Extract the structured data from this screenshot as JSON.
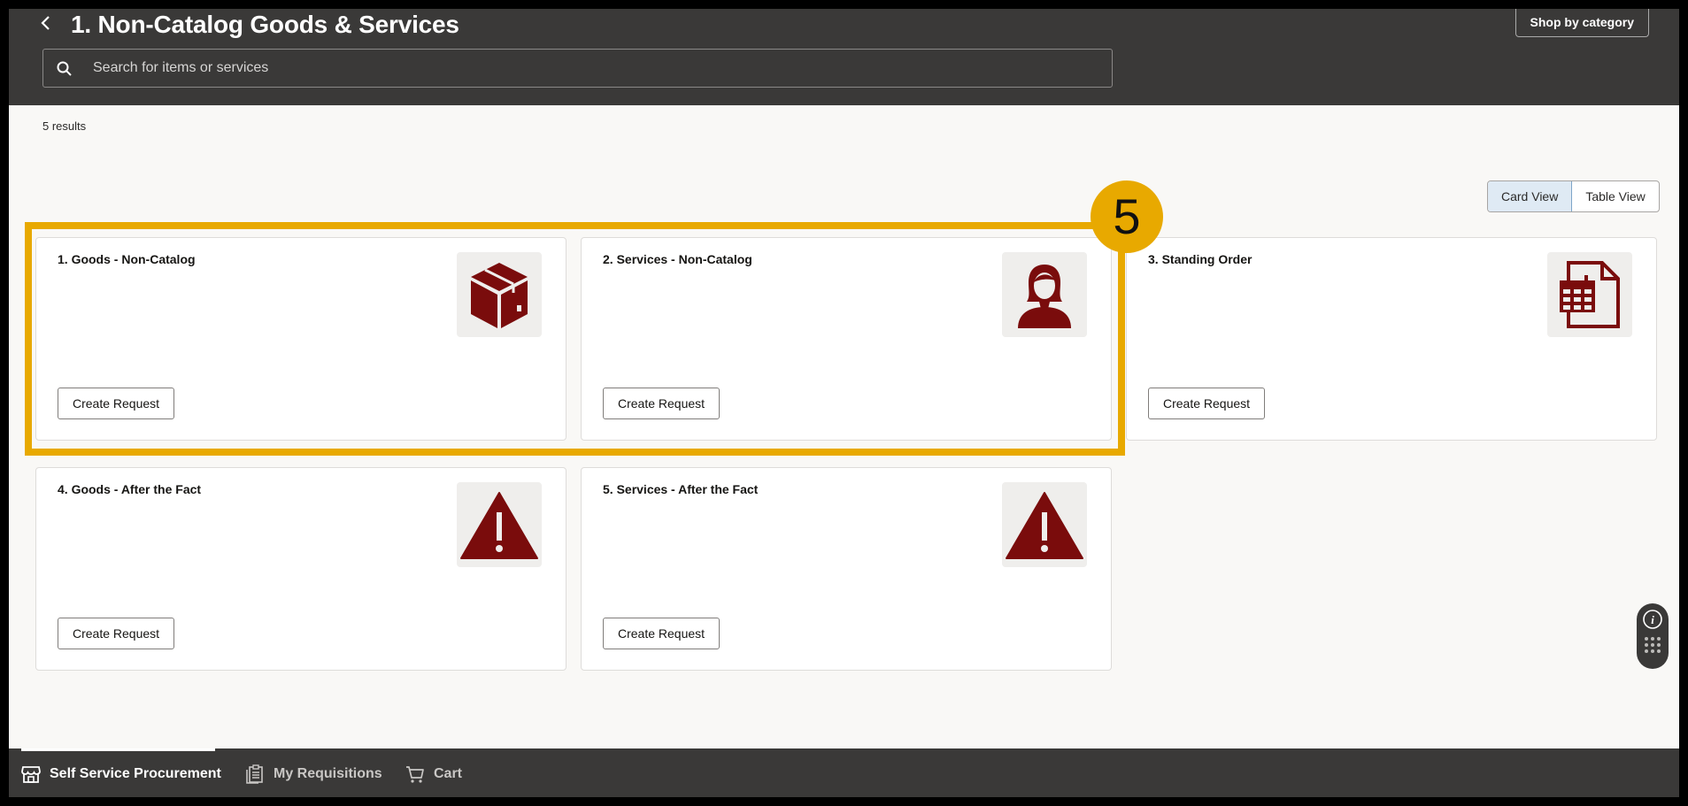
{
  "header": {
    "title": "1. Non-Catalog Goods & Services",
    "shop_by_category": "Shop by category",
    "search_placeholder": "Search for items or services"
  },
  "results_count": "5 results",
  "view_toggle": {
    "card": "Card View",
    "table": "Table View",
    "selected": "Card View"
  },
  "cards": [
    {
      "title": "1. Goods - Non-Catalog",
      "button": "Create Request",
      "icon": "package-icon"
    },
    {
      "title": "2. Services - Non-Catalog",
      "button": "Create Request",
      "icon": "person-icon"
    },
    {
      "title": "3. Standing Order",
      "button": "Create Request",
      "icon": "calendar-document-icon"
    },
    {
      "title": "4. Goods - After the Fact",
      "button": "Create Request",
      "icon": "warning-icon"
    },
    {
      "title": "5. Services - After the Fact",
      "button": "Create Request",
      "icon": "warning-icon"
    }
  ],
  "step_badge": "5",
  "colors": {
    "header_bg": "#3a3938",
    "icon_red": "#7a0c0c",
    "highlight": "#e8a900"
  },
  "footer": {
    "tabs": [
      {
        "label": "Self Service Procurement",
        "icon": "store-icon",
        "active": true
      },
      {
        "label": "My Requisitions",
        "icon": "clipboard-icon",
        "active": false
      },
      {
        "label": "Cart",
        "icon": "cart-icon",
        "active": false
      }
    ]
  }
}
